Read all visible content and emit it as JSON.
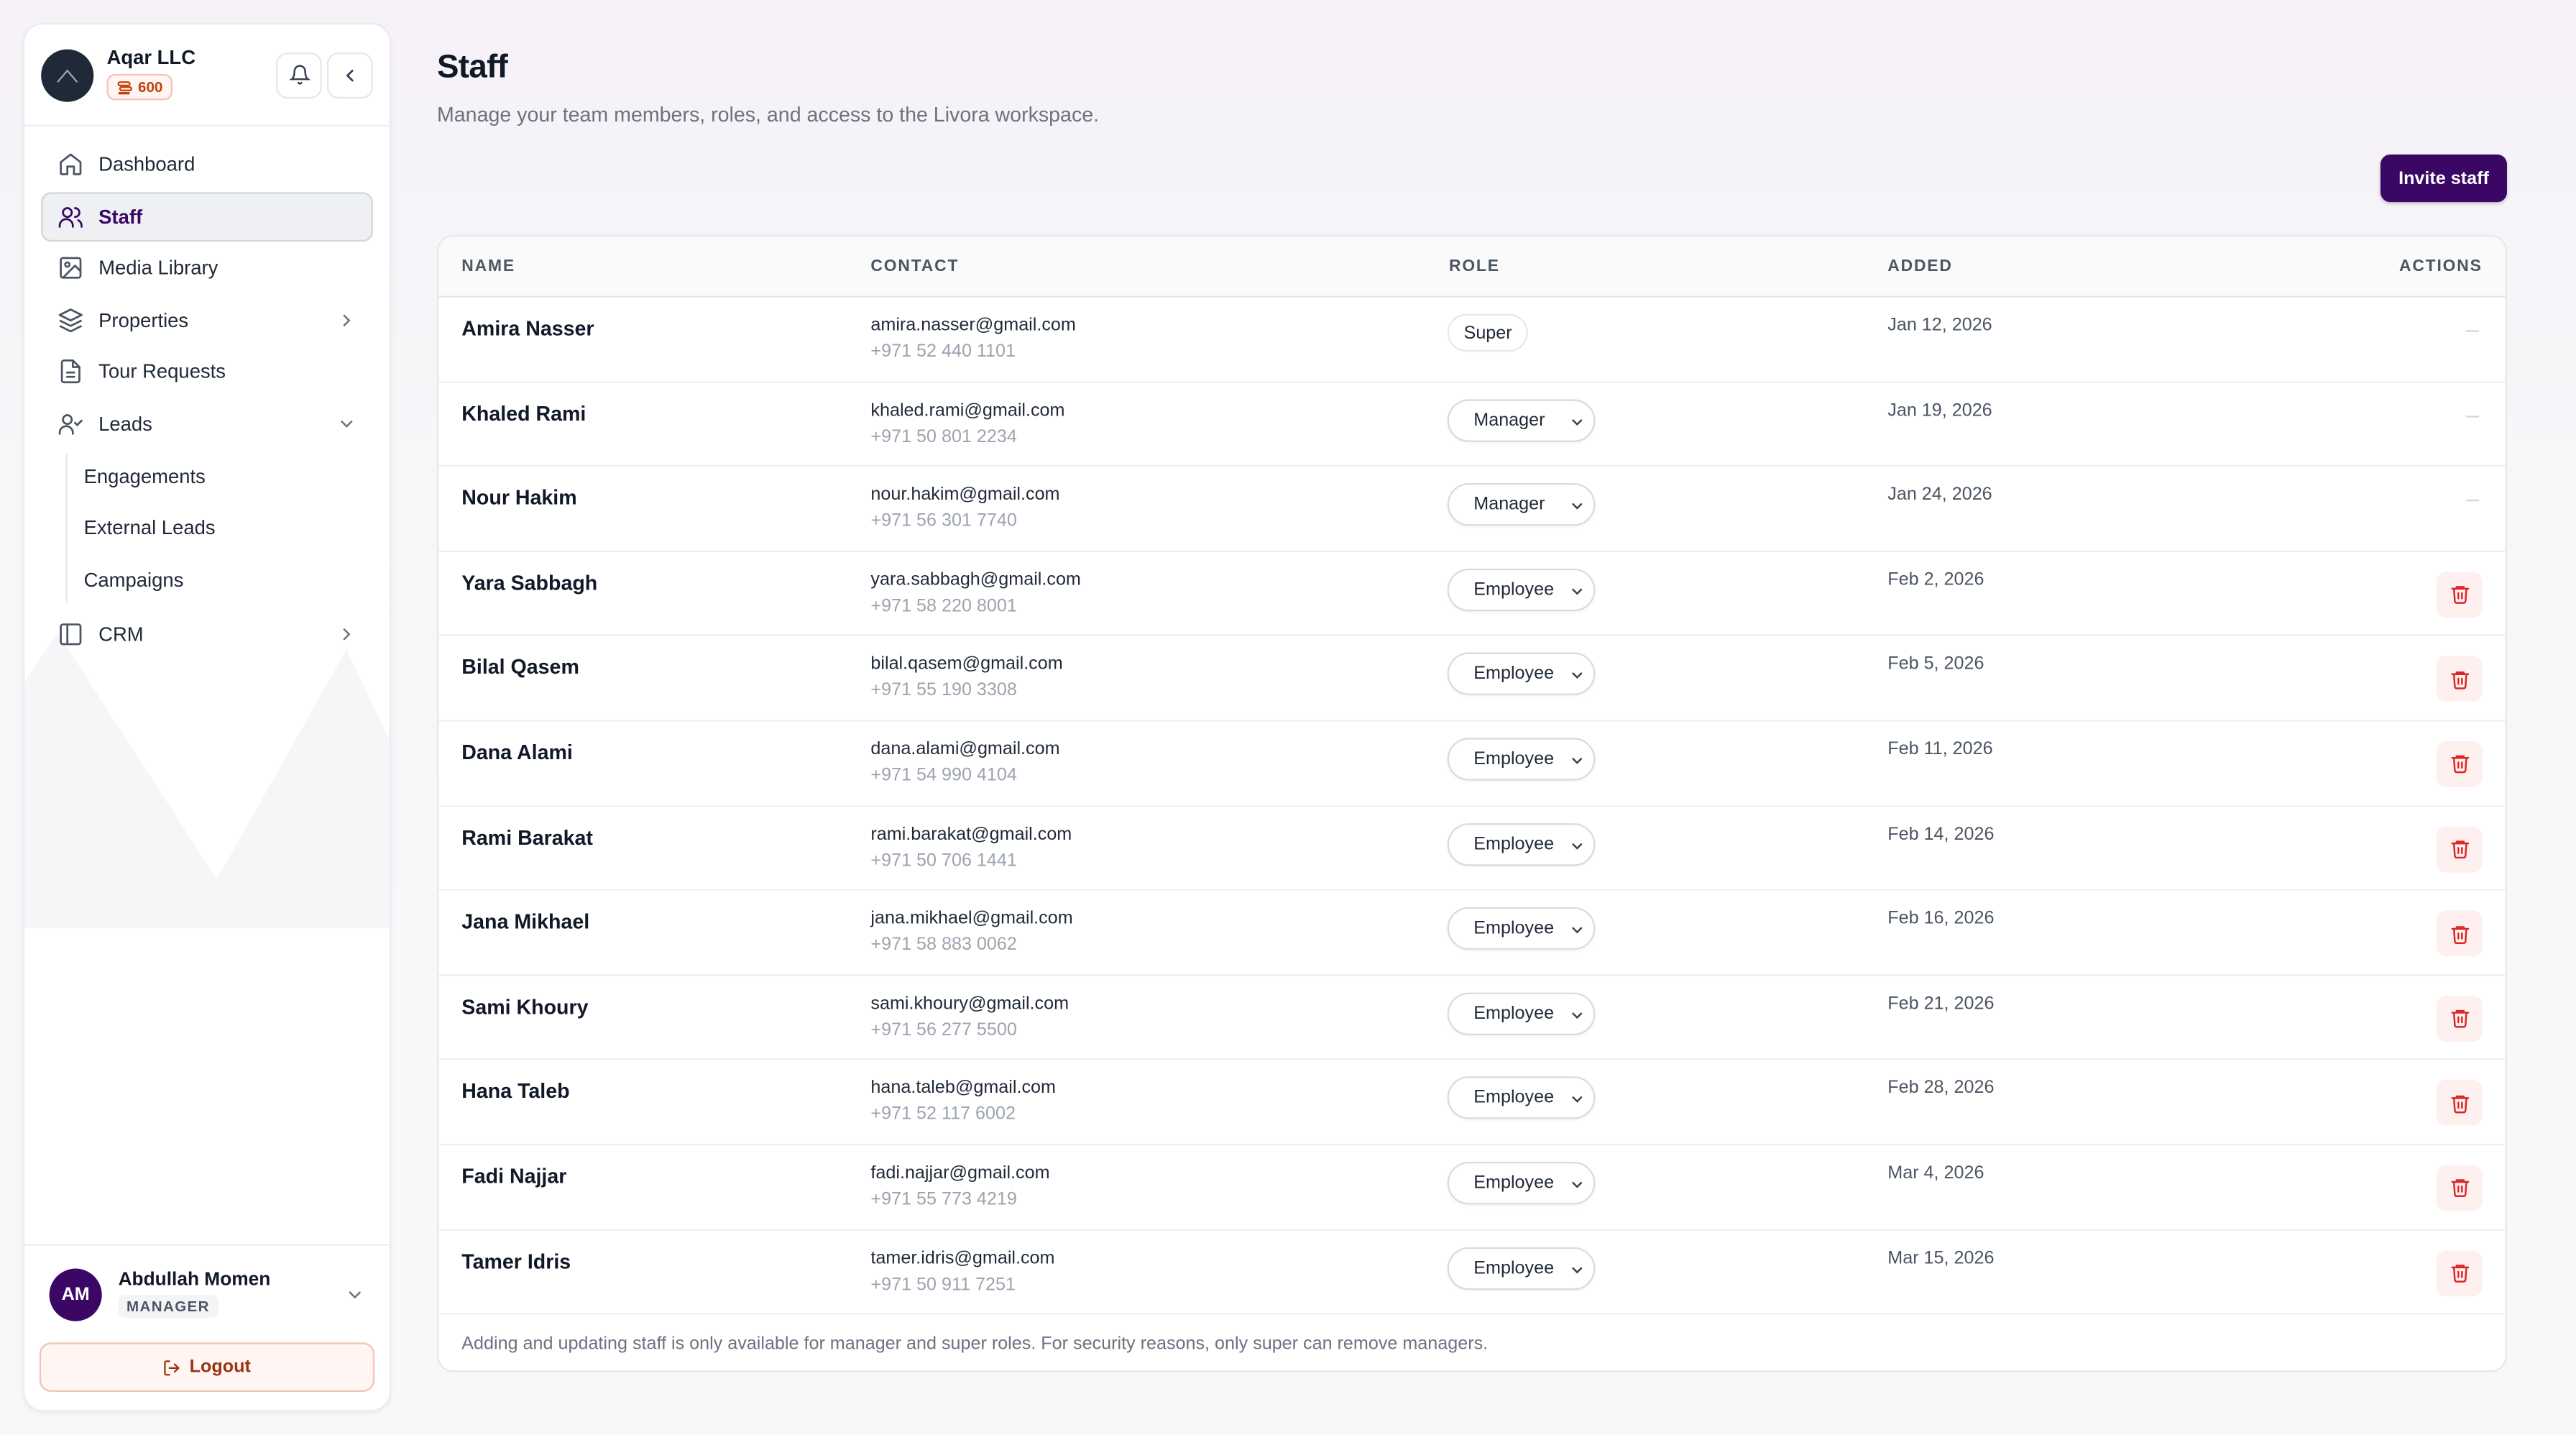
{
  "org": {
    "name": "Aqar LLC",
    "credits": "600"
  },
  "nav": {
    "items": [
      {
        "label": "Dashboard",
        "icon": "home-icon"
      },
      {
        "label": "Staff",
        "icon": "users-icon",
        "active": true
      },
      {
        "label": "Media Library",
        "icon": "image-icon"
      },
      {
        "label": "Properties",
        "icon": "layers-icon",
        "chevron": "right"
      },
      {
        "label": "Tour Requests",
        "icon": "document-icon"
      },
      {
        "label": "Leads",
        "icon": "user-check-icon",
        "chevron": "down"
      }
    ],
    "sub_items": [
      "Engagements",
      "External Leads",
      "Campaigns"
    ],
    "crm": {
      "label": "CRM",
      "icon": "book-icon"
    }
  },
  "user": {
    "initials": "AM",
    "name": "Abdullah Momen",
    "role": "MANAGER"
  },
  "logout_label": "Logout",
  "page": {
    "title": "Staff",
    "subtitle": "Manage your team members, roles, and access to the Livora workspace.",
    "invite_label": "Invite staff"
  },
  "table": {
    "headers": {
      "name": "NAME",
      "contact": "CONTACT",
      "role": "ROLE",
      "added": "ADDED",
      "actions": "ACTIONS"
    },
    "rows": [
      {
        "name": "Amira Nasser",
        "email": "amira.nasser@gmail.com",
        "phone": "+971 52 440 1101",
        "role": "Super",
        "added": "Jan 12, 2026",
        "action": "none"
      },
      {
        "name": "Khaled Rami",
        "email": "khaled.rami@gmail.com",
        "phone": "+971 50 801 2234",
        "role": "Manager",
        "added": "Jan 19, 2026",
        "action": "none"
      },
      {
        "name": "Nour Hakim",
        "email": "nour.hakim@gmail.com",
        "phone": "+971 56 301 7740",
        "role": "Manager",
        "added": "Jan 24, 2026",
        "action": "none"
      },
      {
        "name": "Yara Sabbagh",
        "email": "yara.sabbagh@gmail.com",
        "phone": "+971 58 220 8001",
        "role": "Employee",
        "added": "Feb 2, 2026",
        "action": "delete"
      },
      {
        "name": "Bilal Qasem",
        "email": "bilal.qasem@gmail.com",
        "phone": "+971 55 190 3308",
        "role": "Employee",
        "added": "Feb 5, 2026",
        "action": "delete"
      },
      {
        "name": "Dana Alami",
        "email": "dana.alami@gmail.com",
        "phone": "+971 54 990 4104",
        "role": "Employee",
        "added": "Feb 11, 2026",
        "action": "delete"
      },
      {
        "name": "Rami Barakat",
        "email": "rami.barakat@gmail.com",
        "phone": "+971 50 706 1441",
        "role": "Employee",
        "added": "Feb 14, 2026",
        "action": "delete"
      },
      {
        "name": "Jana Mikhael",
        "email": "jana.mikhael@gmail.com",
        "phone": "+971 58 883 0062",
        "role": "Employee",
        "added": "Feb 16, 2026",
        "action": "delete"
      },
      {
        "name": "Sami Khoury",
        "email": "sami.khoury@gmail.com",
        "phone": "+971 56 277 5500",
        "role": "Employee",
        "added": "Feb 21, 2026",
        "action": "delete"
      },
      {
        "name": "Hana Taleb",
        "email": "hana.taleb@gmail.com",
        "phone": "+971 52 117 6002",
        "role": "Employee",
        "added": "Feb 28, 2026",
        "action": "delete"
      },
      {
        "name": "Fadi Najjar",
        "email": "fadi.najjar@gmail.com",
        "phone": "+971 55 773 4219",
        "role": "Employee",
        "added": "Mar 4, 2026",
        "action": "delete"
      },
      {
        "name": "Tamer Idris",
        "email": "tamer.idris@gmail.com",
        "phone": "+971 50 911 7251",
        "role": "Employee",
        "added": "Mar 15, 2026",
        "action": "delete"
      }
    ],
    "footnote": "Adding and updating staff is only available for manager and super roles. For security reasons, only super can remove managers."
  },
  "colors": {
    "brand": "#3b0764",
    "danger": "#dc2626",
    "credits": "#c2410c"
  }
}
